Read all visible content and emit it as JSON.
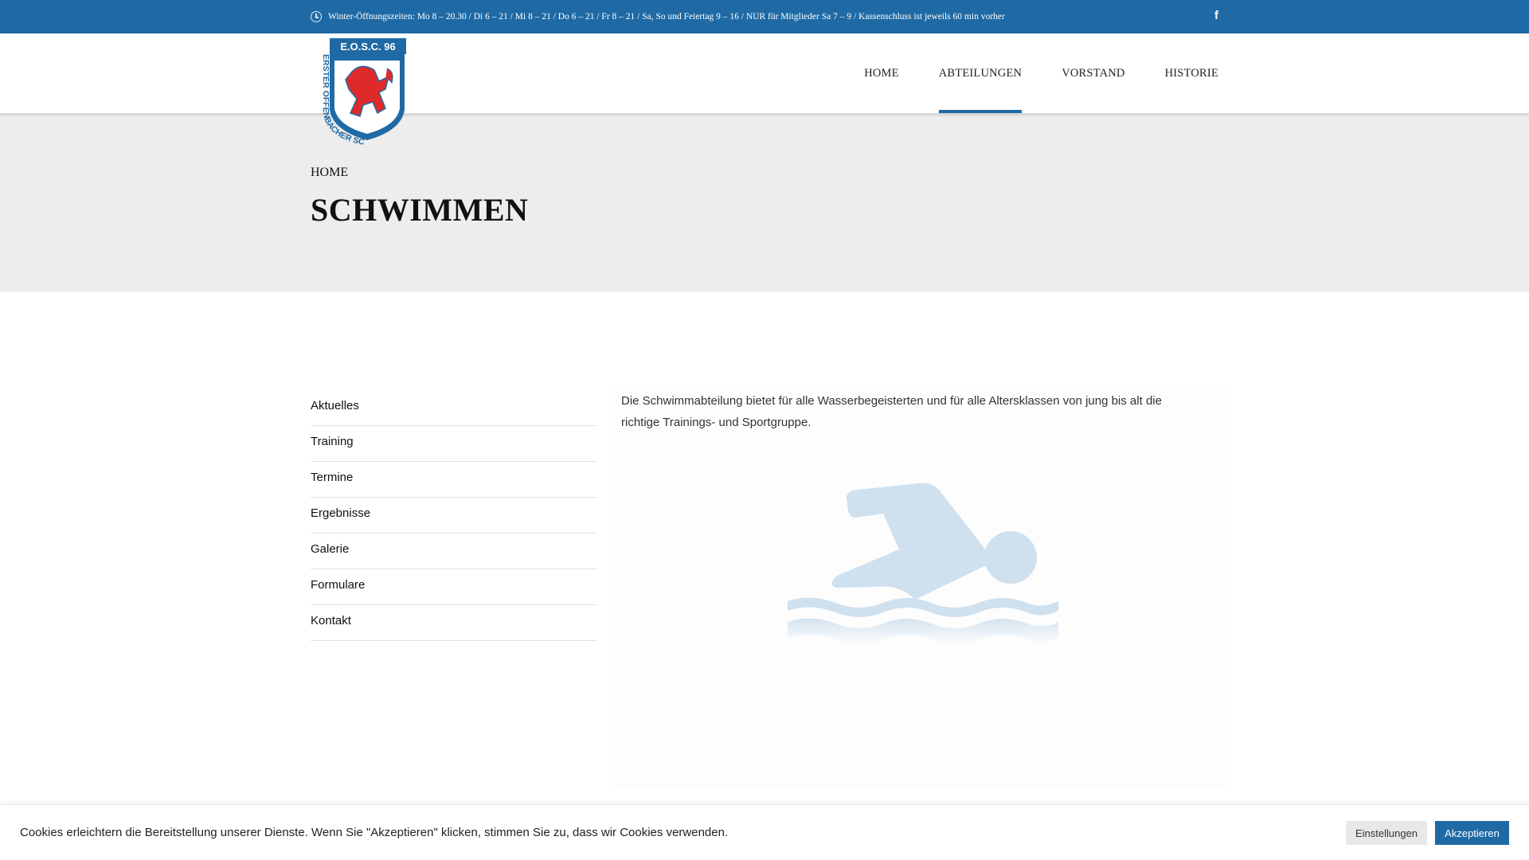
{
  "topbar": {
    "hours_text": "Winter-Öffnungszeiten: Mo 8 – 20.30 / Di 6 – 21 / Mi 8 – 21 / Do 6 – 21 / Fr 8 – 21 / Sa, So und Feiertag 9 – 16 / NUR für Mitglieder Sa 7 – 9 / Kassenschluss ist jeweils 60 min vorher",
    "clock_icon": "clock-icon",
    "facebook_icon": "facebook-icon",
    "facebook_glyph": "f"
  },
  "header": {
    "logo": {
      "name": "logo-eosc",
      "top_text": "E.O.S.C. 96",
      "ring_text": "ERSTER OFFENBACHER SCHWIMM-CLUB 1896"
    },
    "nav": [
      {
        "label": "HOME",
        "active": false
      },
      {
        "label": "ABTEILUNGEN",
        "active": true
      },
      {
        "label": "VORSTAND",
        "active": false
      },
      {
        "label": "HISTORIE",
        "active": false
      }
    ]
  },
  "hero": {
    "breadcrumb": "HOME",
    "title": "SCHWIMMEN"
  },
  "sidebar": {
    "items": [
      "Aktuelles",
      "Training",
      "Termine",
      "Ergebnisse",
      "Galerie",
      "Formulare",
      "Kontakt"
    ]
  },
  "content": {
    "intro": "Die Schwimmabteilung bietet für alle Wasserbegeisterten und für alle Altersklassen von jung bis alt die richtige Trainings- und Sportgruppe.",
    "illustration_icon": "swimmer-icon"
  },
  "cookie": {
    "text": "Cookies erleichtern die Bereitstellung unserer Dienste. Wenn Sie \"Akzeptieren\" klicken, stimmen Sie zu, dass wir Cookies verwenden.",
    "settings_label": "Einstellungen",
    "accept_label": "Akzeptieren"
  },
  "colors": {
    "brand_blue": "#1f6aa5",
    "logo_red": "#e02a2a",
    "hero_bg": "#ededed",
    "swimmer_blue": "#cfe0ef"
  }
}
